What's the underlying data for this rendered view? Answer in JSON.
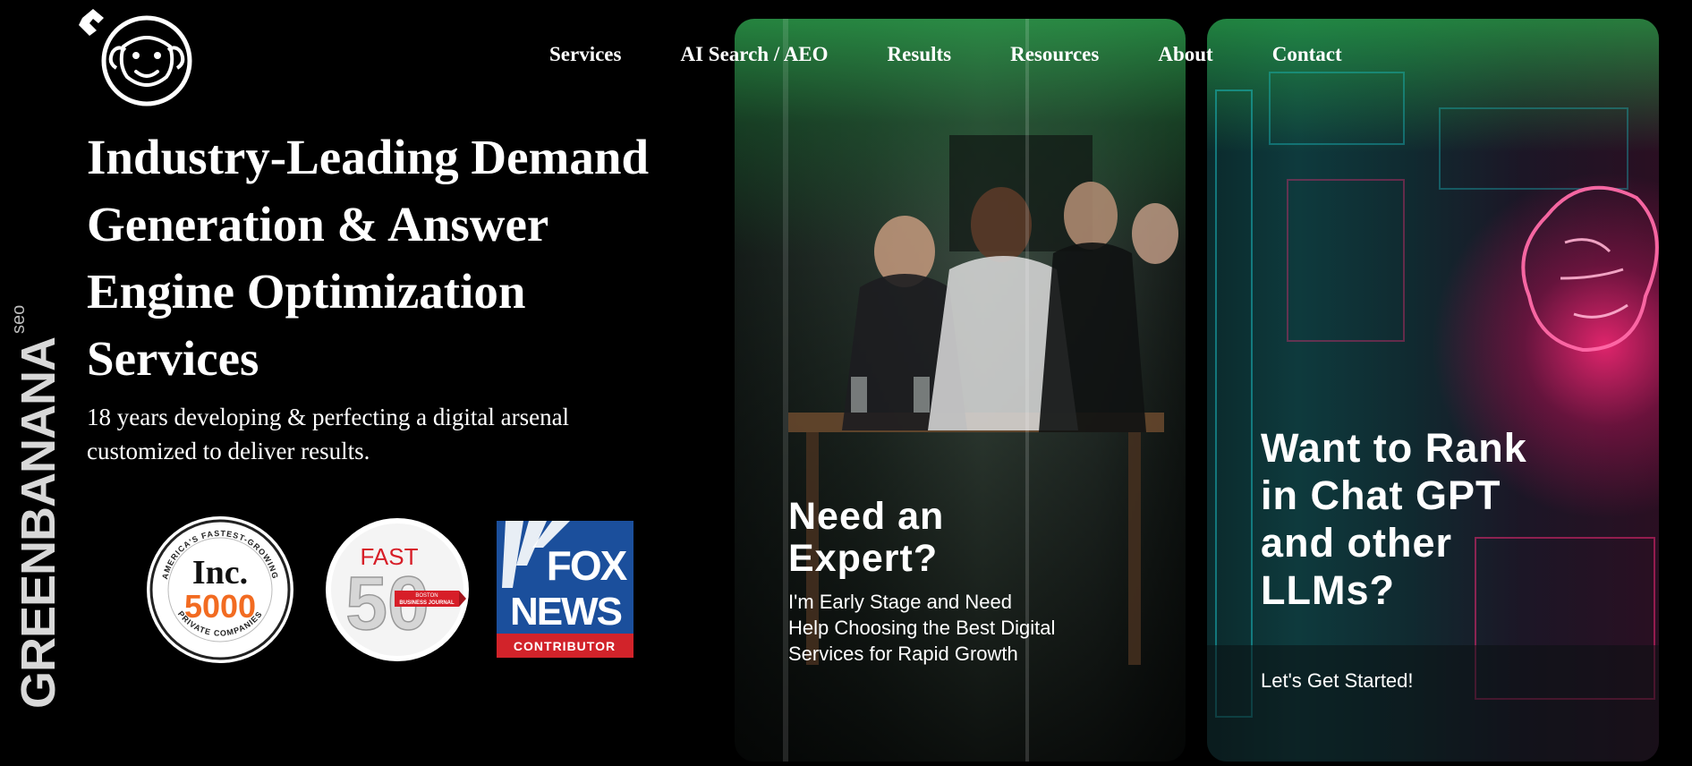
{
  "brand": {
    "logo_icon": "monkey-face-logo",
    "wordmark": "GREENBANANA",
    "wordmark_suffix": "seo"
  },
  "nav": {
    "items": [
      {
        "label": "Services"
      },
      {
        "label": "AI Search / AEO"
      },
      {
        "label": "Results"
      },
      {
        "label": "Resources"
      },
      {
        "label": "About"
      },
      {
        "label": "Contact"
      }
    ]
  },
  "hero": {
    "title": "Industry-Leading Demand Generation & Answer Engine Optimization Services",
    "subtitle": "18 years developing & perfecting a digital arsenal customized to deliver results."
  },
  "badges": {
    "inc": {
      "top_text": "AMERICA'S FASTEST-GROWING",
      "brand": "Inc.",
      "number": "5000",
      "bottom_text": "PRIVATE COMPANIES"
    },
    "fast50": {
      "word": "FAST",
      "number": "50",
      "ribbon_line1": "BOSTON",
      "ribbon_line2": "BUSINESS JOURNAL"
    },
    "fox": {
      "line1": "FOX",
      "line2": "NEWS",
      "tag": "CONTRIBUTOR"
    }
  },
  "cards": {
    "expert": {
      "title_line1": "Need an",
      "title_line2": "Expert?",
      "text": "I'm Early Stage and Need Help Choosing the Best Digital Services for Rapid Growth"
    },
    "llm": {
      "title": "Want to Rank in Chat GPT and other LLMs?",
      "text": "Let's Get Started!"
    }
  },
  "colors": {
    "background": "#000000",
    "text": "#ffffff",
    "fox_blue": "#1b4f9c",
    "fox_red": "#d2232a",
    "inc_orange": "#f26b21",
    "inc_blue": "#1e5aa8",
    "fast_red": "#d71e28",
    "neon_pink": "#ff2a7a",
    "teal": "#19c2c8",
    "green_glow": "#2f9a4a"
  }
}
